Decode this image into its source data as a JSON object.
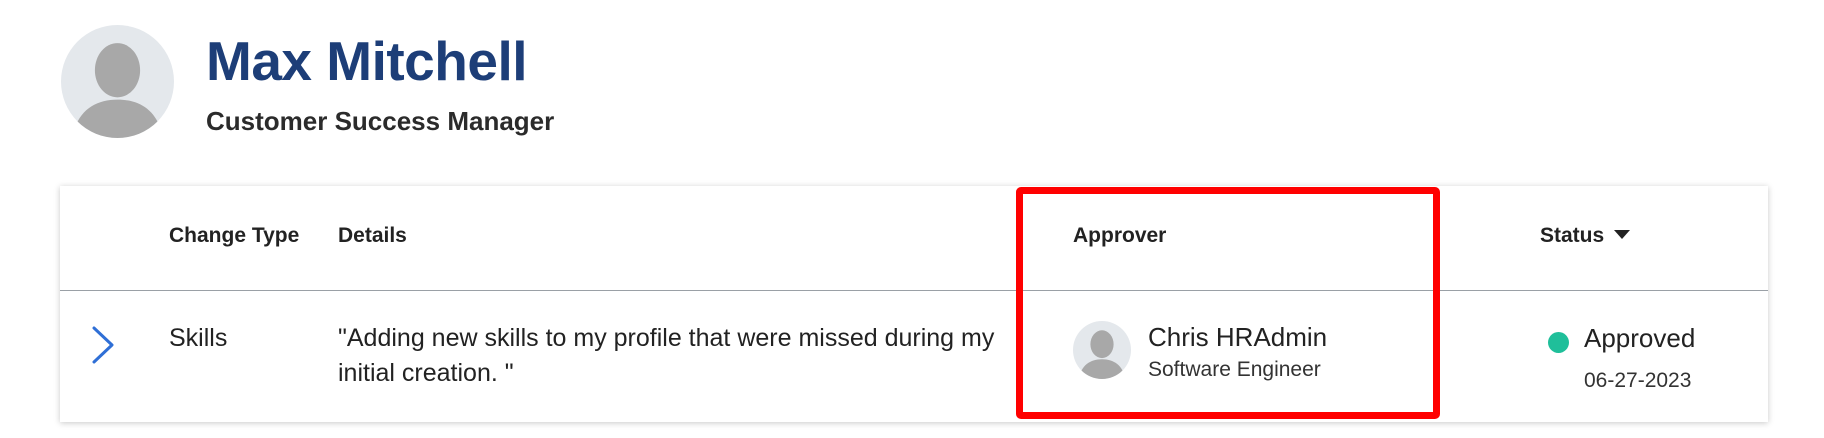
{
  "profile": {
    "name": "Max Mitchell",
    "title": "Customer Success Manager",
    "avatar_icon": "user-silhouette-icon"
  },
  "table": {
    "columns": {
      "change_type": "Change Type",
      "details": "Details",
      "approver": "Approver",
      "status": "Status"
    },
    "status_sort_icon": "caret-down-icon",
    "rows": [
      {
        "expand_icon": "chevron-right-icon",
        "change_type": "Skills",
        "details": "\"Adding new skills to my profile that were missed during my initial creation. \"",
        "approver_name": "Chris HRAdmin",
        "approver_role": "Software Engineer",
        "approver_avatar_icon": "user-silhouette-icon",
        "status": "Approved",
        "status_date": "06-27-2023"
      }
    ]
  },
  "colors": {
    "name_text": "#1d3e78",
    "expand_chevron": "#2f6fd6",
    "status_approved": "#1fbf9a",
    "highlight": "#ff0000",
    "avatar_bg": "#e4e8ec",
    "avatar_figure": "#a8a8a8"
  }
}
